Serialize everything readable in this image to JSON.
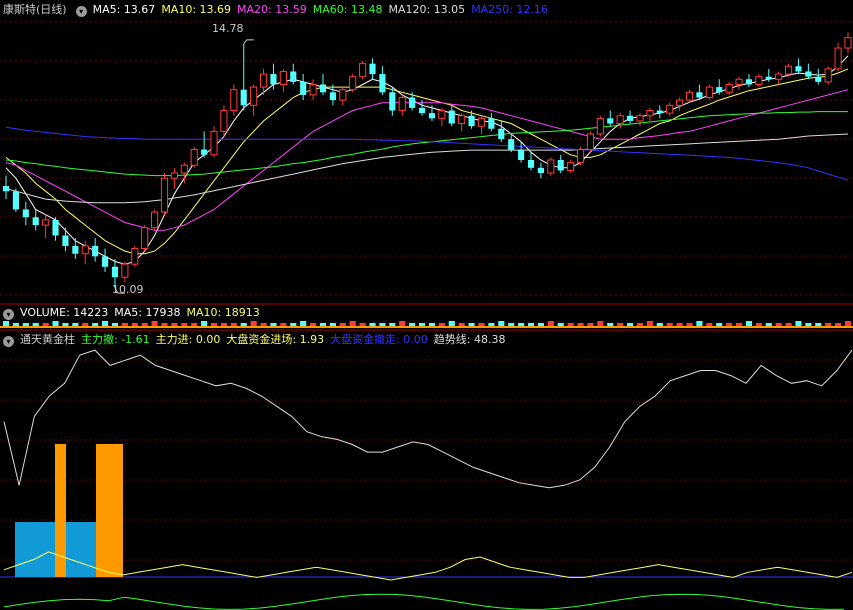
{
  "price_panel": {
    "title": "康斯特(日线)",
    "ma": [
      {
        "label": "MA5: 13.67",
        "color": "#ffffff"
      },
      {
        "label": "MA10: 13.69",
        "color": "#ffff66"
      },
      {
        "label": "MA20: 13.59",
        "color": "#ff44ff"
      },
      {
        "label": "MA60: 13.48",
        "color": "#33ff33"
      },
      {
        "label": "MA120: 13.05",
        "color": "#dddddd"
      },
      {
        "label": "MA250: 12.16",
        "color": "#3333ff"
      }
    ],
    "high_label": "14.78",
    "low_label": "10.09",
    "colors": {
      "up": "#ff3b3b",
      "down": "#54ffff",
      "grid": "#7a0000"
    },
    "candles": [
      [
        12.05,
        12.25,
        11.8,
        11.95
      ],
      [
        11.95,
        12.0,
        11.55,
        11.6
      ],
      [
        11.6,
        11.75,
        11.3,
        11.45
      ],
      [
        11.45,
        11.6,
        11.2,
        11.3
      ],
      [
        11.3,
        11.5,
        11.05,
        11.4
      ],
      [
        11.4,
        11.45,
        11.0,
        11.1
      ],
      [
        11.1,
        11.25,
        10.8,
        10.9
      ],
      [
        10.9,
        11.05,
        10.65,
        10.75
      ],
      [
        10.75,
        11.0,
        10.55,
        10.9
      ],
      [
        10.9,
        11.05,
        10.6,
        10.7
      ],
      [
        10.7,
        10.85,
        10.4,
        10.5
      ],
      [
        10.5,
        10.65,
        10.09,
        10.3
      ],
      [
        10.3,
        10.6,
        10.2,
        10.55
      ],
      [
        10.55,
        10.9,
        10.5,
        10.85
      ],
      [
        10.85,
        11.3,
        10.8,
        11.25
      ],
      [
        11.25,
        11.6,
        11.2,
        11.55
      ],
      [
        11.55,
        12.3,
        11.5,
        12.2
      ],
      [
        12.2,
        12.4,
        12.0,
        12.3
      ],
      [
        12.3,
        12.5,
        12.1,
        12.45
      ],
      [
        12.45,
        12.8,
        12.4,
        12.75
      ],
      [
        12.75,
        13.1,
        12.6,
        12.65
      ],
      [
        12.65,
        13.2,
        12.6,
        13.1
      ],
      [
        13.1,
        13.6,
        13.0,
        13.5
      ],
      [
        13.5,
        14.0,
        13.4,
        13.9
      ],
      [
        13.9,
        14.78,
        13.5,
        13.6
      ],
      [
        13.6,
        14.0,
        13.4,
        13.95
      ],
      [
        13.95,
        14.3,
        13.8,
        14.2
      ],
      [
        14.2,
        14.4,
        13.9,
        14.0
      ],
      [
        14.0,
        14.3,
        13.85,
        14.25
      ],
      [
        14.25,
        14.4,
        14.0,
        14.05
      ],
      [
        14.05,
        14.2,
        13.7,
        13.8
      ],
      [
        13.8,
        14.1,
        13.7,
        14.0
      ],
      [
        14.0,
        14.2,
        13.8,
        13.85
      ],
      [
        13.85,
        14.0,
        13.6,
        13.7
      ],
      [
        13.7,
        13.95,
        13.6,
        13.9
      ],
      [
        13.9,
        14.2,
        13.85,
        14.15
      ],
      [
        14.15,
        14.45,
        14.1,
        14.4
      ],
      [
        14.4,
        14.5,
        14.1,
        14.2
      ],
      [
        14.2,
        14.35,
        13.8,
        13.85
      ],
      [
        13.85,
        13.95,
        13.4,
        13.5
      ],
      [
        13.5,
        13.8,
        13.4,
        13.75
      ],
      [
        13.75,
        13.85,
        13.5,
        13.55
      ],
      [
        13.55,
        13.7,
        13.4,
        13.45
      ],
      [
        13.45,
        13.6,
        13.3,
        13.35
      ],
      [
        13.35,
        13.55,
        13.2,
        13.5
      ],
      [
        13.5,
        13.6,
        13.2,
        13.25
      ],
      [
        13.25,
        13.45,
        13.1,
        13.4
      ],
      [
        13.4,
        13.5,
        13.15,
        13.2
      ],
      [
        13.2,
        13.4,
        13.05,
        13.35
      ],
      [
        13.35,
        13.45,
        13.1,
        13.15
      ],
      [
        13.15,
        13.3,
        12.9,
        12.95
      ],
      [
        12.95,
        13.05,
        12.7,
        12.75
      ],
      [
        12.75,
        12.9,
        12.5,
        12.55
      ],
      [
        12.55,
        12.7,
        12.35,
        12.4
      ],
      [
        12.4,
        12.5,
        12.2,
        12.3
      ],
      [
        12.3,
        12.6,
        12.25,
        12.55
      ],
      [
        12.55,
        12.65,
        12.3,
        12.35
      ],
      [
        12.35,
        12.55,
        12.3,
        12.5
      ],
      [
        12.5,
        12.8,
        12.45,
        12.75
      ],
      [
        12.75,
        13.1,
        12.7,
        13.05
      ],
      [
        13.05,
        13.4,
        13.0,
        13.35
      ],
      [
        13.35,
        13.5,
        13.2,
        13.25
      ],
      [
        13.25,
        13.45,
        13.15,
        13.4
      ],
      [
        13.4,
        13.5,
        13.25,
        13.3
      ],
      [
        13.3,
        13.45,
        13.2,
        13.4
      ],
      [
        13.4,
        13.55,
        13.3,
        13.5
      ],
      [
        13.5,
        13.6,
        13.35,
        13.45
      ],
      [
        13.45,
        13.65,
        13.4,
        13.6
      ],
      [
        13.6,
        13.75,
        13.5,
        13.7
      ],
      [
        13.7,
        13.9,
        13.65,
        13.85
      ],
      [
        13.85,
        14.0,
        13.7,
        13.75
      ],
      [
        13.75,
        14.0,
        13.7,
        13.95
      ],
      [
        13.95,
        14.1,
        13.8,
        13.85
      ],
      [
        13.85,
        14.05,
        13.8,
        14.0
      ],
      [
        14.0,
        14.15,
        13.9,
        14.1
      ],
      [
        14.1,
        14.2,
        13.95,
        14.0
      ],
      [
        14.0,
        14.2,
        13.95,
        14.15
      ],
      [
        14.15,
        14.3,
        14.05,
        14.1
      ],
      [
        14.1,
        14.25,
        14.0,
        14.2
      ],
      [
        14.2,
        14.4,
        14.15,
        14.35
      ],
      [
        14.35,
        14.5,
        14.2,
        14.25
      ],
      [
        14.25,
        14.4,
        14.1,
        14.15
      ],
      [
        14.15,
        14.3,
        14.0,
        14.05
      ],
      [
        14.05,
        14.35,
        14.0,
        14.3
      ],
      [
        14.3,
        14.8,
        14.25,
        14.7
      ],
      [
        14.7,
        15.0,
        14.6,
        14.9
      ]
    ],
    "ma_lines": [
      {
        "name": "MA5",
        "color": "#ffffff",
        "values": [
          12.4,
          12.2,
          11.9,
          11.6,
          11.5,
          11.4,
          11.2,
          11.0,
          10.9,
          10.8,
          10.7,
          10.6,
          10.55,
          10.6,
          10.8,
          11.1,
          11.5,
          11.9,
          12.2,
          12.5,
          12.65,
          12.8,
          13.0,
          13.3,
          13.55,
          13.7,
          13.85,
          14.0,
          14.05,
          14.1,
          14.05,
          14.0,
          13.95,
          13.9,
          13.85,
          13.9,
          14.0,
          14.1,
          14.05,
          13.95,
          13.8,
          13.7,
          13.6,
          13.55,
          13.5,
          13.45,
          13.4,
          13.35,
          13.3,
          13.28,
          13.2,
          13.05,
          12.9,
          12.7,
          12.55,
          12.45,
          12.4,
          12.4,
          12.5,
          12.7,
          12.9,
          13.1,
          13.25,
          13.35,
          13.38,
          13.42,
          13.45,
          13.5,
          13.58,
          13.66,
          13.72,
          13.8,
          13.86,
          13.92,
          13.98,
          14.02,
          14.06,
          14.1,
          14.13,
          14.18,
          14.22,
          14.2,
          14.18,
          14.2,
          14.35,
          14.55
        ]
      },
      {
        "name": "MA10",
        "color": "#ffff66",
        "values": [
          12.6,
          12.45,
          12.3,
          12.1,
          11.95,
          11.8,
          11.6,
          11.45,
          11.3,
          11.15,
          11.0,
          10.9,
          10.8,
          10.75,
          10.75,
          10.8,
          10.95,
          11.15,
          11.4,
          11.65,
          11.9,
          12.15,
          12.4,
          12.65,
          12.9,
          13.1,
          13.3,
          13.45,
          13.6,
          13.75,
          13.85,
          13.9,
          13.95,
          13.95,
          13.95,
          13.95,
          13.95,
          13.95,
          13.95,
          13.9,
          13.85,
          13.8,
          13.75,
          13.7,
          13.65,
          13.6,
          13.5,
          13.45,
          13.4,
          13.35,
          13.3,
          13.25,
          13.15,
          13.05,
          12.95,
          12.85,
          12.75,
          12.65,
          12.6,
          12.6,
          12.65,
          12.75,
          12.85,
          12.95,
          13.05,
          13.15,
          13.25,
          13.3,
          13.4,
          13.48,
          13.55,
          13.62,
          13.7,
          13.76,
          13.82,
          13.88,
          13.92,
          13.96,
          14.0,
          14.04,
          14.08,
          14.12,
          14.14,
          14.16,
          14.22,
          14.3
        ]
      },
      {
        "name": "MA20",
        "color": "#ff44ff",
        "values": [
          12.5,
          12.45,
          12.35,
          12.25,
          12.15,
          12.05,
          11.95,
          11.85,
          11.75,
          11.65,
          11.55,
          11.45,
          11.35,
          11.3,
          11.25,
          11.2,
          11.2,
          11.25,
          11.3,
          11.4,
          11.5,
          11.6,
          11.75,
          11.9,
          12.05,
          12.2,
          12.35,
          12.5,
          12.65,
          12.8,
          12.95,
          13.1,
          13.2,
          13.3,
          13.4,
          13.5,
          13.55,
          13.6,
          13.65,
          13.65,
          13.65,
          13.65,
          13.65,
          13.65,
          13.65,
          13.62,
          13.6,
          13.58,
          13.55,
          13.5,
          13.45,
          13.4,
          13.35,
          13.3,
          13.25,
          13.2,
          13.15,
          13.1,
          13.05,
          13.0,
          12.95,
          12.95,
          12.95,
          12.95,
          12.98,
          13.0,
          13.02,
          13.05,
          13.08,
          13.1,
          13.15,
          13.2,
          13.25,
          13.3,
          13.35,
          13.4,
          13.45,
          13.5,
          13.55,
          13.6,
          13.65,
          13.7,
          13.75,
          13.8,
          13.85,
          13.9
        ]
      },
      {
        "name": "MA60",
        "color": "#33ff33",
        "values": [
          12.55,
          12.53,
          12.5,
          12.48,
          12.45,
          12.43,
          12.4,
          12.38,
          12.36,
          12.34,
          12.32,
          12.3,
          12.28,
          12.27,
          12.26,
          12.25,
          12.25,
          12.25,
          12.26,
          12.27,
          12.28,
          12.3,
          12.32,
          12.34,
          12.36,
          12.38,
          12.4,
          12.42,
          12.45,
          12.48,
          12.5,
          12.53,
          12.56,
          12.6,
          12.63,
          12.66,
          12.7,
          12.73,
          12.76,
          12.8,
          12.83,
          12.86,
          12.88,
          12.9,
          12.92,
          12.94,
          12.96,
          12.98,
          13.0,
          13.02,
          13.04,
          13.06,
          13.07,
          13.08,
          13.09,
          13.1,
          13.11,
          13.12,
          13.14,
          13.16,
          13.18,
          13.2,
          13.22,
          13.24,
          13.26,
          13.28,
          13.3,
          13.32,
          13.34,
          13.36,
          13.38,
          13.4,
          13.41,
          13.42,
          13.43,
          13.44,
          13.45,
          13.45,
          13.46,
          13.46,
          13.47,
          13.47,
          13.48,
          13.48,
          13.48,
          13.48
        ]
      },
      {
        "name": "MA120",
        "color": "#dddddd",
        "values": [
          12.0,
          11.95,
          11.9,
          11.85,
          11.8,
          11.78,
          11.76,
          11.75,
          11.74,
          11.73,
          11.73,
          11.73,
          11.73,
          11.74,
          11.75,
          11.77,
          11.79,
          11.82,
          11.85,
          11.88,
          11.92,
          11.96,
          12.0,
          12.04,
          12.08,
          12.12,
          12.16,
          12.2,
          12.24,
          12.28,
          12.32,
          12.36,
          12.4,
          12.44,
          12.48,
          12.51,
          12.54,
          12.57,
          12.6,
          12.62,
          12.64,
          12.66,
          12.68,
          12.7,
          12.71,
          12.72,
          12.73,
          12.74,
          12.74,
          12.74,
          12.74,
          12.74,
          12.74,
          12.74,
          12.74,
          12.74,
          12.74,
          12.74,
          12.75,
          12.76,
          12.77,
          12.78,
          12.79,
          12.8,
          12.81,
          12.82,
          12.83,
          12.84,
          12.85,
          12.86,
          12.87,
          12.88,
          12.89,
          12.9,
          12.91,
          12.92,
          12.93,
          12.94,
          12.95,
          12.97,
          12.99,
          13.01,
          13.02,
          13.03,
          13.04,
          13.05
        ]
      },
      {
        "name": "MA250",
        "color": "#3333ff",
        "values": [
          13.18,
          13.15,
          13.12,
          13.1,
          13.08,
          13.06,
          13.04,
          13.02,
          13.0,
          12.99,
          12.98,
          12.97,
          12.96,
          12.96,
          12.95,
          12.95,
          12.95,
          12.95,
          12.95,
          12.95,
          12.95,
          12.95,
          12.95,
          12.95,
          12.95,
          12.95,
          12.95,
          12.95,
          12.95,
          12.95,
          12.95,
          12.95,
          12.95,
          12.95,
          12.95,
          12.95,
          12.94,
          12.94,
          12.93,
          12.93,
          12.92,
          12.92,
          12.91,
          12.9,
          12.89,
          12.88,
          12.87,
          12.86,
          12.85,
          12.84,
          12.83,
          12.82,
          12.81,
          12.8,
          12.79,
          12.78,
          12.77,
          12.76,
          12.75,
          12.74,
          12.73,
          12.72,
          12.71,
          12.7,
          12.69,
          12.68,
          12.67,
          12.66,
          12.65,
          12.64,
          12.63,
          12.62,
          12.61,
          12.6,
          12.58,
          12.56,
          12.54,
          12.52,
          12.5,
          12.47,
          12.44,
          12.4,
          12.34,
          12.28,
          12.22,
          12.16
        ]
      }
    ]
  },
  "volume_panel": {
    "labels": [
      {
        "text": "VOLUME: 14223",
        "color": "#ffffff"
      },
      {
        "text": "MA5: 17938",
        "color": "#ffffff"
      },
      {
        "text": "MA10: 18913",
        "color": "#ffff66"
      }
    ]
  },
  "indicator_panel": {
    "title": "通天黄金柱",
    "labels": [
      {
        "text": "主力撤: -1.61",
        "color": "#33ff33"
      },
      {
        "text": "主力进: 0.00",
        "color": "#ffff66"
      },
      {
        "text": "大盘资金进场: 1.93",
        "color": "#ffff66"
      },
      {
        "text": "大盘资金撤走: 0.00",
        "color": "#3333ff"
      },
      {
        "text": "趋势线: 48.38",
        "color": "#dddddd"
      }
    ],
    "bar_colors": {
      "blue": "#129ad6",
      "orange": "#ff9900"
    },
    "bars_blue": [
      [
        15,
        522,
        80,
        55
      ]
    ],
    "trend_line": [
      70,
      45,
      72,
      80,
      85,
      96,
      98,
      92,
      94,
      96,
      92,
      90,
      88,
      86,
      84,
      85,
      83,
      80,
      76,
      72,
      66,
      64,
      63,
      61,
      58,
      58,
      60,
      62,
      61,
      58,
      55,
      52,
      50,
      48,
      46,
      45,
      44,
      45,
      47,
      52,
      60,
      70,
      76,
      80,
      86,
      88,
      90,
      90,
      88,
      85,
      92,
      88,
      85,
      86,
      84,
      90,
      98
    ],
    "yellow_line": [
      15,
      17,
      19,
      22,
      20,
      18,
      16,
      14,
      13,
      14,
      15,
      16,
      17,
      16,
      15,
      14,
      13,
      12,
      13,
      14,
      15,
      16,
      15,
      14,
      13,
      12,
      11,
      12,
      13,
      14,
      16,
      19,
      20,
      18,
      16,
      15,
      14,
      13,
      12,
      12,
      13,
      14,
      15,
      16,
      17,
      16,
      15,
      14,
      13,
      12,
      14,
      15,
      16,
      15,
      14,
      13,
      12,
      14
    ]
  }
}
